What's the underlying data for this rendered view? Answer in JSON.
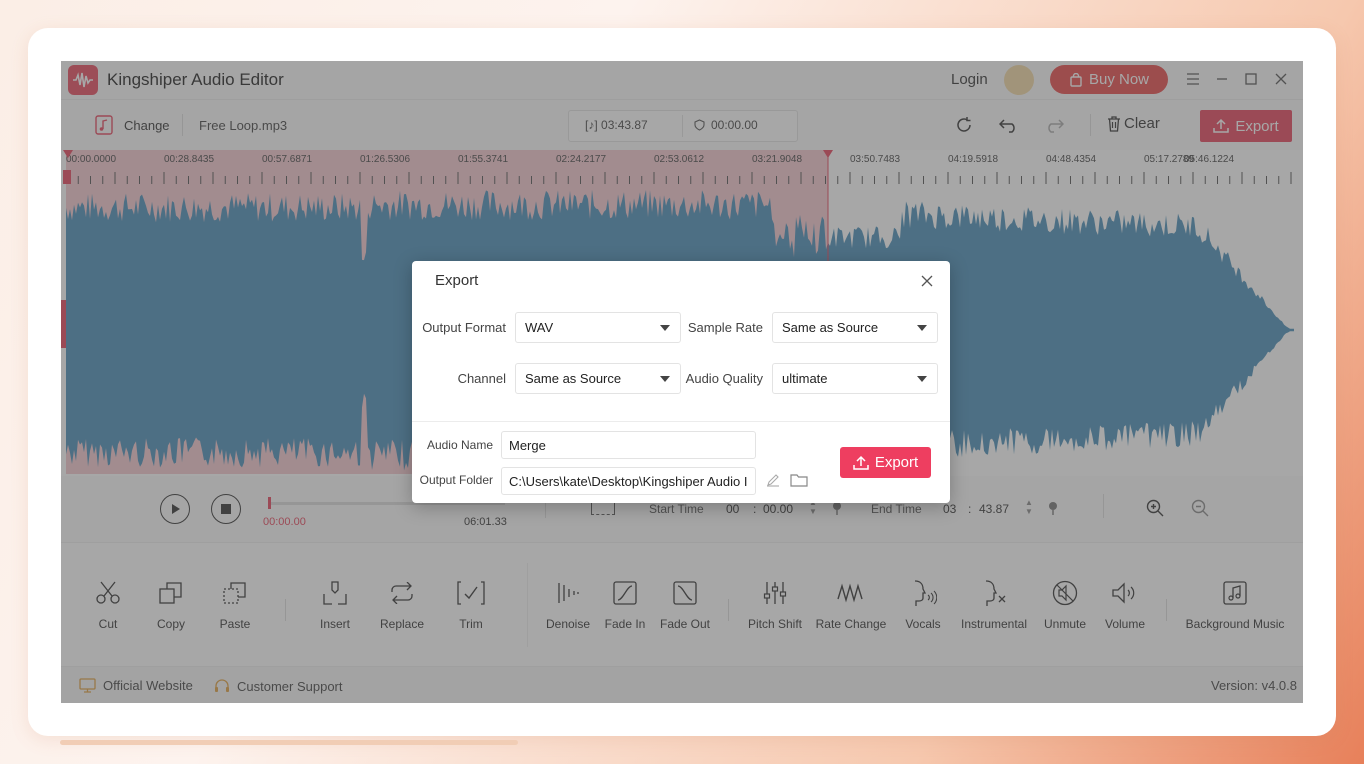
{
  "app": {
    "title": "Kingshiper Audio Editor",
    "login": "Login",
    "buy_now": "Buy Now",
    "version": "Version: v4.0.8"
  },
  "toolbar": {
    "change": "Change",
    "file_name": "Free Loop.mp3",
    "duration": "03:43.87",
    "selection_time": "00:00.00",
    "clear": "Clear",
    "export": "Export"
  },
  "timeline": {
    "ticks": [
      "00:00.0000",
      "00:28.8435",
      "00:57.6871",
      "01:26.5306",
      "01:55.3741",
      "02:24.2177",
      "02:53.0612",
      "03:21.9048",
      "03:50.7483",
      "04:19.5918",
      "04:48.4354",
      "05:17.2789",
      "05:46.1224"
    ]
  },
  "transport": {
    "current_time": "00:00.00",
    "total_time": "06:01.33",
    "start_label": "Start Time",
    "start_min": "00",
    "start_sec": "00.00",
    "end_label": "End Time",
    "end_min": "03",
    "end_sec": "43.87",
    "colon": ":"
  },
  "tools": {
    "cut": "Cut",
    "copy": "Copy",
    "paste": "Paste",
    "insert": "Insert",
    "replace": "Replace",
    "trim": "Trim",
    "denoise": "Denoise",
    "fade_in": "Fade In",
    "fade_out": "Fade Out",
    "pitch_shift": "Pitch Shift",
    "rate_change": "Rate Change",
    "vocals": "Vocals",
    "instrumental": "Instrumental",
    "unmute": "Unmute",
    "volume": "Volume",
    "background_music": "Background Music"
  },
  "footer": {
    "official_website": "Official Website",
    "customer_support": "Customer Support"
  },
  "export_dialog": {
    "title": "Export",
    "output_format_label": "Output Format",
    "output_format": "WAV",
    "sample_rate_label": "Sample Rate",
    "sample_rate": "Same as Source",
    "channel_label": "Channel",
    "channel": "Same as Source",
    "audio_quality_label": "Audio Quality",
    "audio_quality": "ultimate",
    "audio_name_label": "Audio Name",
    "audio_name": "Merge",
    "output_folder_label": "Output Folder",
    "output_folder": "C:\\Users\\kate\\Desktop\\Kingshiper Audio I",
    "export_button": "Export"
  },
  "colors": {
    "accent": "#e7455c",
    "waveform": "#4a8fb8",
    "selection": "#f5c9cf"
  }
}
